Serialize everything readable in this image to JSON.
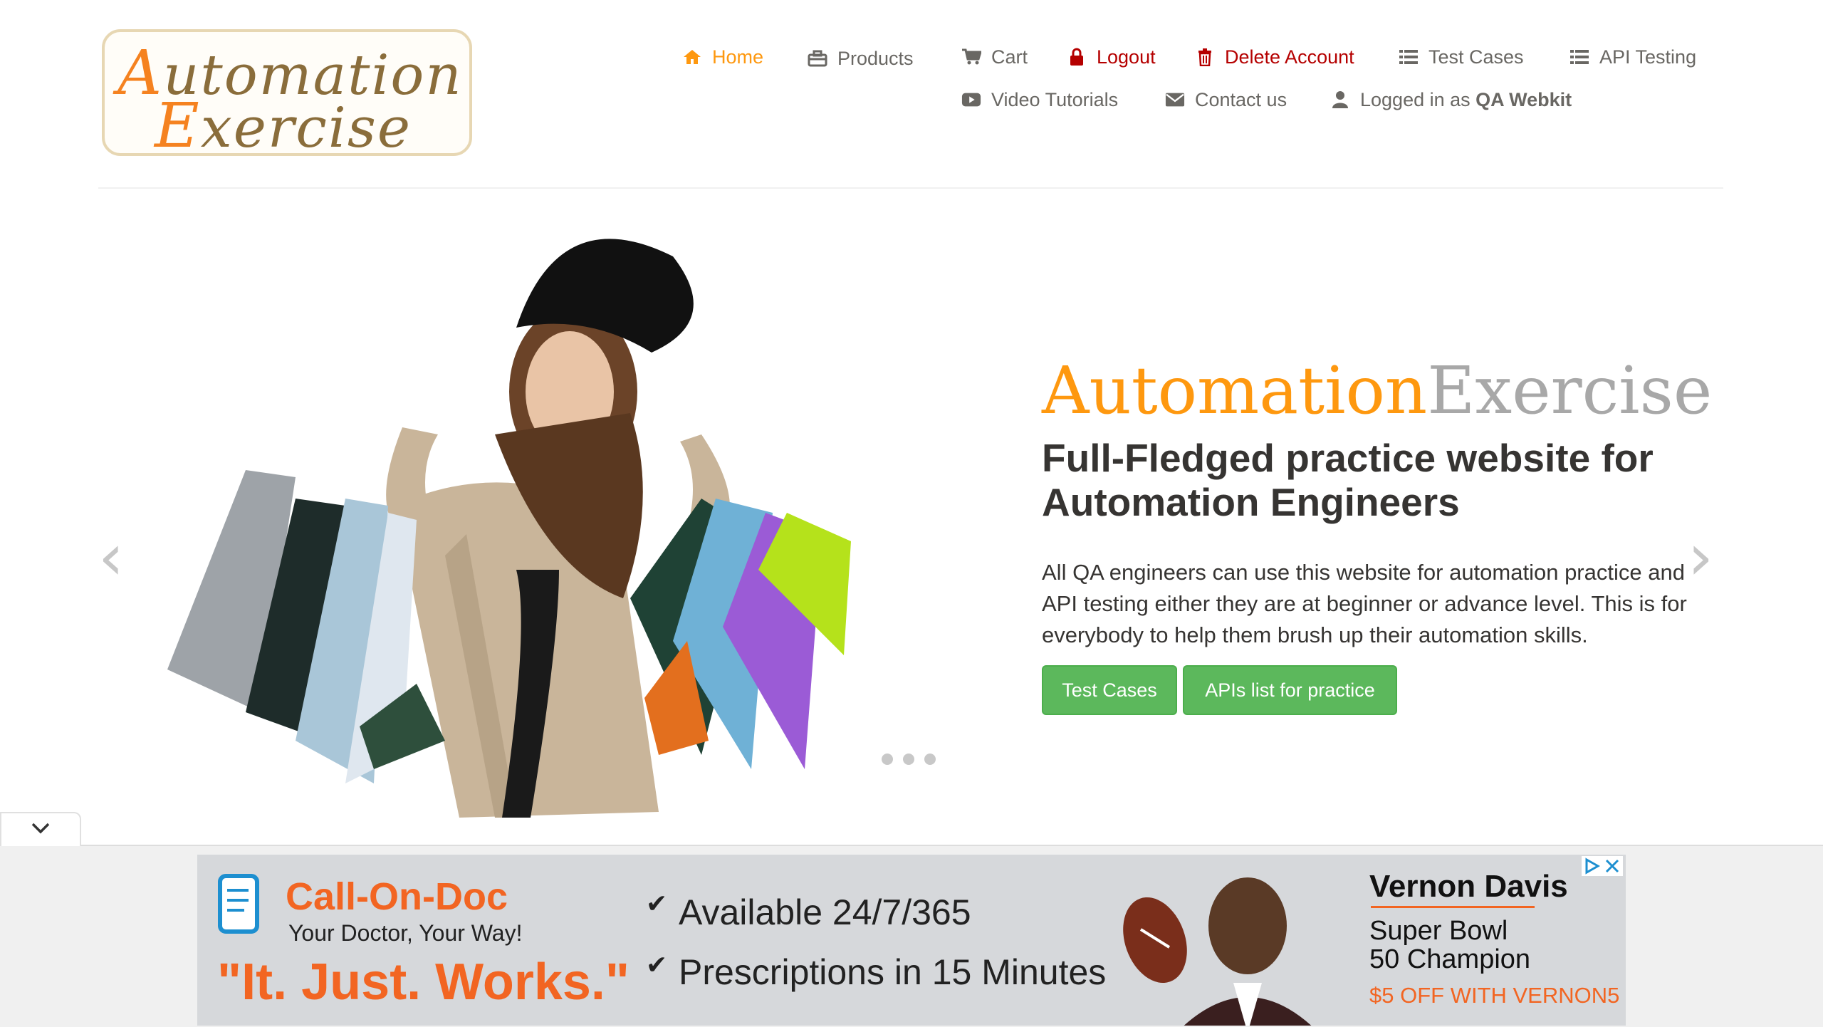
{
  "logo": {
    "line1_cap": "A",
    "line1_rest": "utomation",
    "line2_cap": "E",
    "line2_rest": "xercise"
  },
  "nav": [
    {
      "label": "Home",
      "icon": "home-icon"
    },
    {
      "label": "Products",
      "icon": "briefcase-icon"
    },
    {
      "label": "Cart",
      "icon": "cart-icon"
    },
    {
      "label": "Logout",
      "icon": "lock-icon"
    },
    {
      "label": "Delete Account",
      "icon": "trash-icon"
    },
    {
      "label": "Test Cases",
      "icon": "list-icon"
    },
    {
      "label": "API Testing",
      "icon": "list-icon"
    },
    {
      "label": "Video Tutorials",
      "icon": "youtube-icon"
    },
    {
      "label": "Contact us",
      "icon": "envelope-icon"
    },
    {
      "label_prefix": "Logged in as ",
      "username": "QA Webkit",
      "icon": "user-icon"
    }
  ],
  "hero": {
    "brand_a": "Automation",
    "brand_b": "Exercise",
    "headline": "Full-Fledged practice website for Automation Engineers",
    "description": "All QA engineers can use this website for automation practice and API testing either they are at beginner or advance level. This is for everybody to help them brush up their automation skills.",
    "btn_test_cases": "Test Cases",
    "btn_apis": "APIs list for practice",
    "prev_arrow": "‹",
    "next_arrow": "›"
  },
  "ad": {
    "brand": "Call-On-Doc",
    "tagline": "Your Doctor, Your Way!",
    "slogan": "\"It. Just. Works.\"",
    "point1": "Available 24/7/365",
    "point2": "Prescriptions in 15 Minutes",
    "person": "Vernon Davis",
    "title1": "Super Bowl",
    "title2": "50 Champion",
    "offer": "$5 OFF WITH VERNON5",
    "colors": {
      "blue": "#1d8fd0",
      "orange": "#f26522"
    }
  },
  "colors": {
    "accent": "#fe980f",
    "danger": "#b50000",
    "button": "#5cb85c"
  }
}
